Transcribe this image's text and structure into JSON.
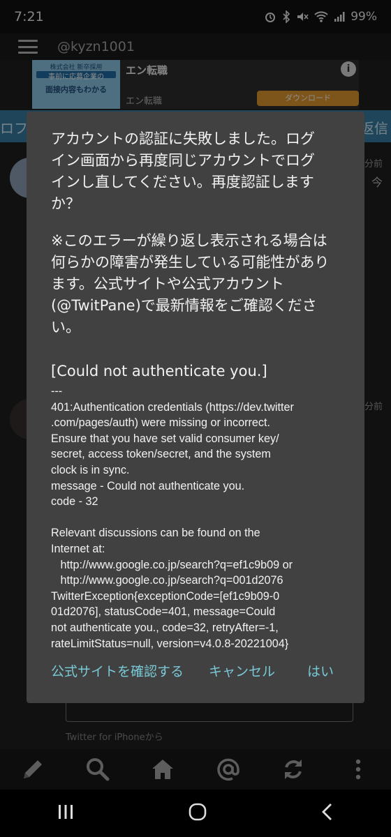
{
  "status_bar": {
    "time": "7:21",
    "battery": "99%"
  },
  "app_bar": {
    "account": "@kyzn1001"
  },
  "ad": {
    "image_text_small": "株式会社 新卒採用",
    "image_text_mid": "事前に応募企業の",
    "image_text_main": "面接内容もわかる",
    "title": "エン転職",
    "subtitle": "エン転職",
    "download_label": "ダウンロード"
  },
  "tabs": {
    "left_fragment": "ロフ",
    "right_fragment": "返信"
  },
  "background_timeline": {
    "time_1": "分前",
    "time_1_extra": "今",
    "time_2": "分前",
    "via": "Twitter for iPhoneから"
  },
  "dialog": {
    "message": "アカウントの認証に失敗しました。ログ\nイン画面から再度同じアカウントでログ\nインし直してください。再度認証します\nか？",
    "notice": "※このエラーが繰り返し表示される場合は何らかの障害が発生している可能性があります。公式サイトや公式アカウント(@TwitPane)で最新情報をご確認ください。",
    "error_heading": "[Could not authenticate you.]",
    "detail": "---\n401:Authentication credentials (https://dev.twitter\n.com/pages/auth) were missing or incorrect.\nEnsure that you have set valid consumer key/\nsecret, access token/secret, and the system\nclock is in sync.\nmessage - Could not authenticate you.\ncode - 32\n\nRelevant discussions can be found on the\nInternet at:\n   http://www.google.co.jp/search?q=ef1c9b09 or\n   http://www.google.co.jp/search?q=001d2076\nTwitterException{exceptionCode=[ef1c9b09-0\n01d2076], statusCode=401, message=Could\nnot authenticate you., code=32, retryAfter=-1,\nrateLimitStatus=null, version=v4.0.8-20221004}",
    "actions": {
      "official_site": "公式サイトを確認する",
      "cancel": "キャンセル",
      "ok": "はい"
    }
  },
  "colors": {
    "dialog_bg": "#414141",
    "accent": "#79c9d6",
    "tab_strip": "#3a7ea6",
    "ad_button": "#e39b32"
  },
  "icons": [
    "alarm-icon",
    "bluetooth-icon",
    "mute-icon",
    "wifi-icon",
    "signal-icon",
    "hamburger-icon",
    "info-icon",
    "compose-icon",
    "search-icon",
    "home-icon",
    "mention-icon",
    "refresh-icon",
    "more-icon",
    "recents-icon",
    "home-nav-icon",
    "back-icon"
  ]
}
